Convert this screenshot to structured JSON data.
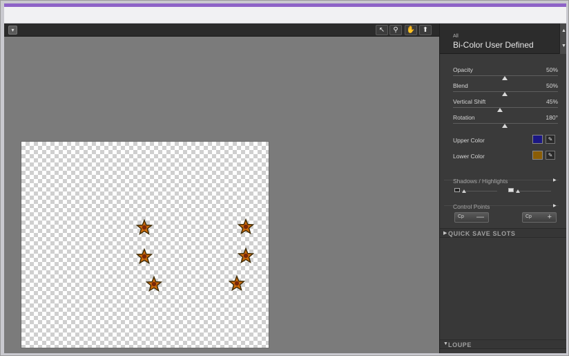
{
  "preview": {
    "view_dropdown_icon": "chevron-down-icon",
    "tools": [
      "arrow-pointer-icon",
      "zoom-icon",
      "hand-icon",
      "pin-icon"
    ]
  },
  "panel": {
    "filter_category": "All",
    "filter_name": "Bi-Color User Defined",
    "sliders": [
      {
        "label": "Opacity",
        "value": "50%",
        "position": 0.5
      },
      {
        "label": "Blend",
        "value": "50%",
        "position": 0.5
      },
      {
        "label": "Vertical Shift",
        "value": "45%",
        "position": 0.45
      },
      {
        "label": "Rotation",
        "value": "180°",
        "position": 0.5
      }
    ],
    "colors": [
      {
        "label": "Upper Color",
        "swatch": "#1b1783"
      },
      {
        "label": "Lower Color",
        "swatch": "#8a5d06"
      }
    ],
    "shadows_highlights_title": "Shadows / Highlights",
    "control_points_title": "Control Points",
    "cp_add_label": "Cp",
    "cp_remove_label": "Cp",
    "quick_save_slots": "QUICK SAVE SLOTS",
    "loupe": "LOUPE"
  },
  "colors": {
    "accent": "#8e63c7",
    "panel_bg": "#3a3a3a",
    "preview_bg": "#7b7b7b"
  }
}
